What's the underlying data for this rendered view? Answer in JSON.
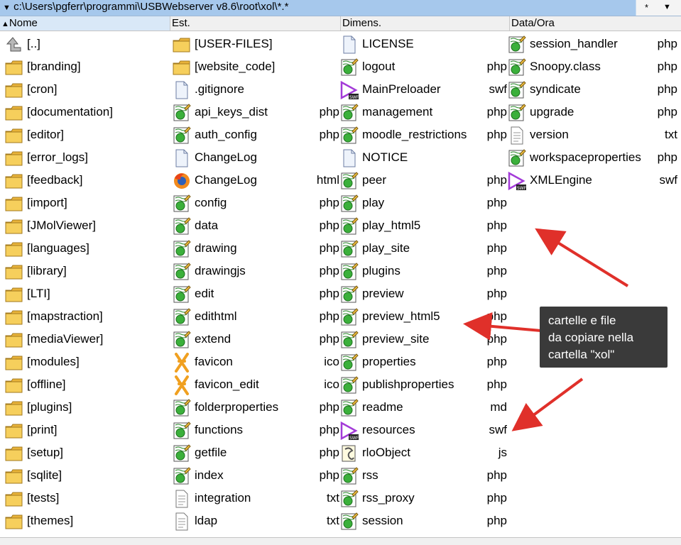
{
  "pathbar": {
    "path": "c:\\Users\\pgferr\\programmi\\USBWebserver v8.6\\root\\xol\\*.*",
    "filter": "*"
  },
  "columns": [
    {
      "label": "Nome",
      "sort": "asc"
    },
    {
      "label": "Est."
    },
    {
      "label": "Dimens."
    },
    {
      "label": "Data/Ora"
    }
  ],
  "files": [
    {
      "col": 0,
      "row": 0,
      "name": "[..]",
      "ext": "",
      "icon": "up-arrow-icon"
    },
    {
      "col": 0,
      "row": 1,
      "name": "[branding]",
      "ext": "",
      "icon": "folder-icon"
    },
    {
      "col": 0,
      "row": 2,
      "name": "[cron]",
      "ext": "",
      "icon": "folder-icon"
    },
    {
      "col": 0,
      "row": 3,
      "name": "[documentation]",
      "ext": "",
      "icon": "folder-icon"
    },
    {
      "col": 0,
      "row": 4,
      "name": "[editor]",
      "ext": "",
      "icon": "folder-icon"
    },
    {
      "col": 0,
      "row": 5,
      "name": "[error_logs]",
      "ext": "",
      "icon": "folder-icon"
    },
    {
      "col": 0,
      "row": 6,
      "name": "[feedback]",
      "ext": "",
      "icon": "folder-icon"
    },
    {
      "col": 0,
      "row": 7,
      "name": "[import]",
      "ext": "",
      "icon": "folder-icon"
    },
    {
      "col": 0,
      "row": 8,
      "name": "[JMolViewer]",
      "ext": "",
      "icon": "folder-icon"
    },
    {
      "col": 0,
      "row": 9,
      "name": "[languages]",
      "ext": "",
      "icon": "folder-icon"
    },
    {
      "col": 0,
      "row": 10,
      "name": "[library]",
      "ext": "",
      "icon": "folder-icon"
    },
    {
      "col": 0,
      "row": 11,
      "name": "[LTI]",
      "ext": "",
      "icon": "folder-icon"
    },
    {
      "col": 0,
      "row": 12,
      "name": "[mapstraction]",
      "ext": "",
      "icon": "folder-icon"
    },
    {
      "col": 0,
      "row": 13,
      "name": "[mediaViewer]",
      "ext": "",
      "icon": "folder-icon"
    },
    {
      "col": 0,
      "row": 14,
      "name": "[modules]",
      "ext": "",
      "icon": "folder-icon"
    },
    {
      "col": 0,
      "row": 15,
      "name": "[offline]",
      "ext": "",
      "icon": "folder-icon"
    },
    {
      "col": 0,
      "row": 16,
      "name": "[plugins]",
      "ext": "",
      "icon": "folder-icon"
    },
    {
      "col": 0,
      "row": 17,
      "name": "[print]",
      "ext": "",
      "icon": "folder-icon"
    },
    {
      "col": 0,
      "row": 18,
      "name": "[setup]",
      "ext": "",
      "icon": "folder-icon"
    },
    {
      "col": 0,
      "row": 19,
      "name": "[sqlite]",
      "ext": "",
      "icon": "folder-icon"
    },
    {
      "col": 0,
      "row": 20,
      "name": "[tests]",
      "ext": "",
      "icon": "folder-icon"
    },
    {
      "col": 0,
      "row": 21,
      "name": "[themes]",
      "ext": "",
      "icon": "folder-icon"
    },
    {
      "col": 1,
      "row": 0,
      "name": "[USER-FILES]",
      "ext": "",
      "icon": "folder-icon"
    },
    {
      "col": 1,
      "row": 1,
      "name": "[website_code]",
      "ext": "",
      "icon": "folder-icon"
    },
    {
      "col": 1,
      "row": 2,
      "name": ".gitignore",
      "ext": "",
      "icon": "document-icon"
    },
    {
      "col": 1,
      "row": 3,
      "name": "api_keys_dist",
      "ext": "php",
      "icon": "php-script-icon"
    },
    {
      "col": 1,
      "row": 4,
      "name": "auth_config",
      "ext": "php",
      "icon": "php-script-icon"
    },
    {
      "col": 1,
      "row": 5,
      "name": "ChangeLog",
      "ext": "",
      "icon": "document-icon"
    },
    {
      "col": 1,
      "row": 6,
      "name": "ChangeLog",
      "ext": "html",
      "icon": "firefox-icon"
    },
    {
      "col": 1,
      "row": 7,
      "name": "config",
      "ext": "php",
      "icon": "php-script-icon"
    },
    {
      "col": 1,
      "row": 8,
      "name": "data",
      "ext": "php",
      "icon": "php-script-icon"
    },
    {
      "col": 1,
      "row": 9,
      "name": "drawing",
      "ext": "php",
      "icon": "php-script-icon"
    },
    {
      "col": 1,
      "row": 10,
      "name": "drawingjs",
      "ext": "php",
      "icon": "php-script-icon"
    },
    {
      "col": 1,
      "row": 11,
      "name": "edit",
      "ext": "php",
      "icon": "php-script-icon"
    },
    {
      "col": 1,
      "row": 12,
      "name": "edithtml",
      "ext": "php",
      "icon": "php-script-icon"
    },
    {
      "col": 1,
      "row": 13,
      "name": "extend",
      "ext": "php",
      "icon": "php-script-icon"
    },
    {
      "col": 1,
      "row": 14,
      "name": "favicon",
      "ext": "ico",
      "icon": "favicon-icon"
    },
    {
      "col": 1,
      "row": 15,
      "name": "favicon_edit",
      "ext": "ico",
      "icon": "favicon-icon"
    },
    {
      "col": 1,
      "row": 16,
      "name": "folderproperties",
      "ext": "php",
      "icon": "php-script-icon"
    },
    {
      "col": 1,
      "row": 17,
      "name": "functions",
      "ext": "php",
      "icon": "php-script-icon"
    },
    {
      "col": 1,
      "row": 18,
      "name": "getfile",
      "ext": "php",
      "icon": "php-script-icon"
    },
    {
      "col": 1,
      "row": 19,
      "name": "index",
      "ext": "php",
      "icon": "php-script-icon"
    },
    {
      "col": 1,
      "row": 20,
      "name": "integration",
      "ext": "txt",
      "icon": "text-file-icon"
    },
    {
      "col": 1,
      "row": 21,
      "name": "ldap",
      "ext": "txt",
      "icon": "text-file-icon"
    },
    {
      "col": 2,
      "row": 0,
      "name": "LICENSE",
      "ext": "",
      "icon": "document-icon"
    },
    {
      "col": 2,
      "row": 1,
      "name": "logout",
      "ext": "php",
      "icon": "php-script-icon"
    },
    {
      "col": 2,
      "row": 2,
      "name": "MainPreloader",
      "ext": "swf",
      "icon": "swf-icon"
    },
    {
      "col": 2,
      "row": 3,
      "name": "management",
      "ext": "php",
      "icon": "php-script-icon"
    },
    {
      "col": 2,
      "row": 4,
      "name": "moodle_restrictions",
      "ext": "php",
      "icon": "php-script-icon"
    },
    {
      "col": 2,
      "row": 5,
      "name": "NOTICE",
      "ext": "",
      "icon": "document-icon"
    },
    {
      "col": 2,
      "row": 6,
      "name": "peer",
      "ext": "php",
      "icon": "php-script-icon"
    },
    {
      "col": 2,
      "row": 7,
      "name": "play",
      "ext": "php",
      "icon": "php-script-icon"
    },
    {
      "col": 2,
      "row": 8,
      "name": "play_html5",
      "ext": "php",
      "icon": "php-script-icon"
    },
    {
      "col": 2,
      "row": 9,
      "name": "play_site",
      "ext": "php",
      "icon": "php-script-icon"
    },
    {
      "col": 2,
      "row": 10,
      "name": "plugins",
      "ext": "php",
      "icon": "php-script-icon"
    },
    {
      "col": 2,
      "row": 11,
      "name": "preview",
      "ext": "php",
      "icon": "php-script-icon"
    },
    {
      "col": 2,
      "row": 12,
      "name": "preview_html5",
      "ext": "php",
      "icon": "php-script-icon"
    },
    {
      "col": 2,
      "row": 13,
      "name": "preview_site",
      "ext": "php",
      "icon": "php-script-icon"
    },
    {
      "col": 2,
      "row": 14,
      "name": "properties",
      "ext": "php",
      "icon": "php-script-icon"
    },
    {
      "col": 2,
      "row": 15,
      "name": "publishproperties",
      "ext": "php",
      "icon": "php-script-icon"
    },
    {
      "col": 2,
      "row": 16,
      "name": "readme",
      "ext": "md",
      "icon": "php-script-icon"
    },
    {
      "col": 2,
      "row": 17,
      "name": "resources",
      "ext": "swf",
      "icon": "swf-icon"
    },
    {
      "col": 2,
      "row": 18,
      "name": "rloObject",
      "ext": "js",
      "icon": "js-script-icon"
    },
    {
      "col": 2,
      "row": 19,
      "name": "rss",
      "ext": "php",
      "icon": "php-script-icon"
    },
    {
      "col": 2,
      "row": 20,
      "name": "rss_proxy",
      "ext": "php",
      "icon": "php-script-icon"
    },
    {
      "col": 2,
      "row": 21,
      "name": "session",
      "ext": "php",
      "icon": "php-script-icon"
    },
    {
      "col": 3,
      "row": 0,
      "name": "session_handler",
      "ext": "php",
      "icon": "php-script-icon"
    },
    {
      "col": 3,
      "row": 1,
      "name": "Snoopy.class",
      "ext": "php",
      "icon": "php-script-icon"
    },
    {
      "col": 3,
      "row": 2,
      "name": "syndicate",
      "ext": "php",
      "icon": "php-script-icon"
    },
    {
      "col": 3,
      "row": 3,
      "name": "upgrade",
      "ext": "php",
      "icon": "php-script-icon"
    },
    {
      "col": 3,
      "row": 4,
      "name": "version",
      "ext": "txt",
      "icon": "text-file-icon"
    },
    {
      "col": 3,
      "row": 5,
      "name": "workspaceproperties",
      "ext": "php",
      "icon": "php-script-icon"
    },
    {
      "col": 3,
      "row": 6,
      "name": "XMLEngine",
      "ext": "swf",
      "icon": "swf-icon"
    }
  ],
  "annotation": {
    "text": "cartelle e file da copiare nella cartella \"xol\"",
    "line1": "cartelle e file",
    "line2": "da copiare nella",
    "line3": "cartella \"xol\"",
    "arrow_color": "#e0302a"
  },
  "colors": {
    "path_bg": "#a6c8ec",
    "folder": "#f3c64a",
    "swf": "#a33bd8"
  }
}
